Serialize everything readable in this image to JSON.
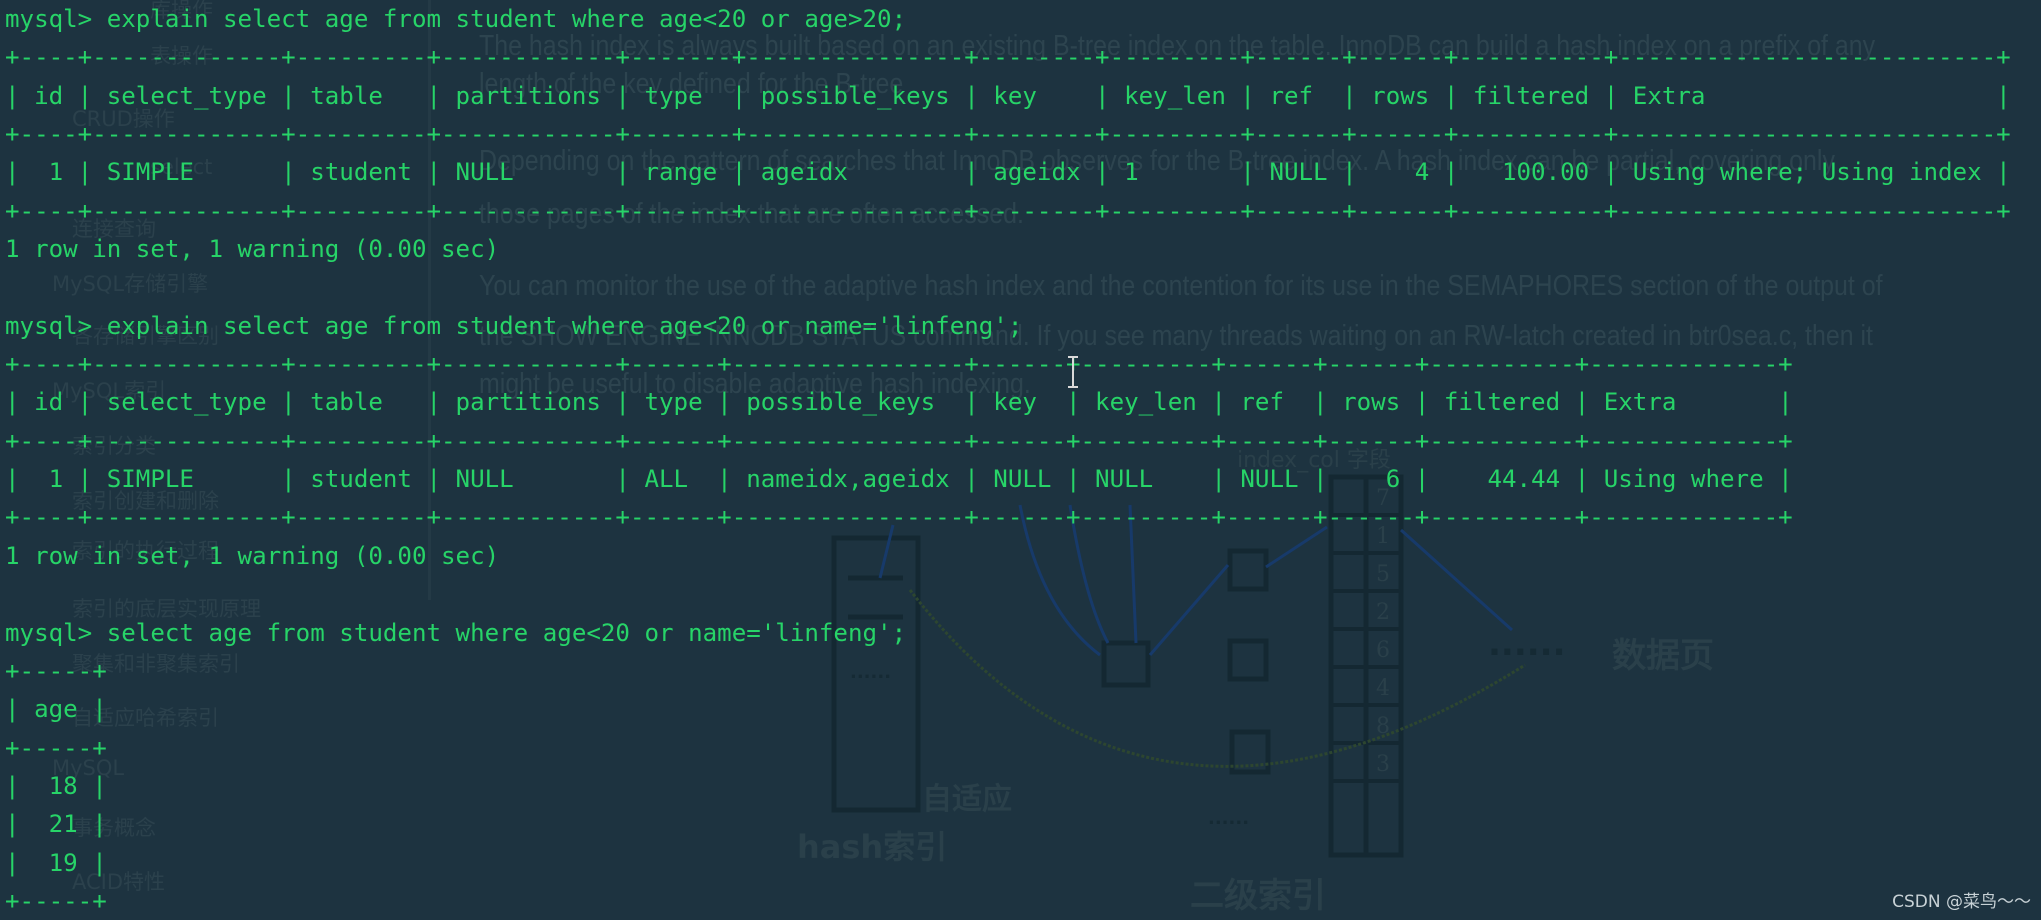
{
  "background_doc": {
    "sidebar_items": [
      "库操作",
      "表操作",
      "CRUD操作",
      "select",
      "连接查询",
      "MySQL存储引擎",
      "各存储引擎区别",
      "MySQL索引",
      "索引分类",
      "索引创建和删除",
      "索引的执行过程",
      "索引的底层实现原理",
      "聚集和非聚集索引",
      "自适应哈希索引",
      "MySQL",
      "事务概念",
      "ACID特性"
    ],
    "paragraphs": [
      "The hash index is always built based on an existing B-tree index on the table. InnoDB can build a hash index on a prefix of any",
      "length of the key defined for the B-tree",
      "Depending on the pattern of searches that InnoDB observes for the B-tree index. A hash index can be partial, covering only",
      "those pages of the index that are often accessed.",
      "You can monitor the use of the adaptive hash index and the contention for its use in the SEMAPHORES section of the output of",
      "the SHOW ENGINE INNODB STATUS command. If you see many threads waiting on an RW-latch created in btr0sea.c, then it",
      "might be useful to disable adaptive hash indexing."
    ],
    "diagram": {
      "hash_label": "hash索引",
      "adaptive_label": "自适应",
      "secondary_label": "二级索引",
      "column_label": "index_col 字段",
      "data_page_label": "数据页",
      "ellipsis": "......",
      "column_values": [
        "7",
        "1",
        "5",
        "2",
        "6",
        "4",
        "8",
        "3"
      ]
    }
  },
  "terminal": {
    "text_color": "#27d468",
    "background_color": "#1d3340",
    "lines": [
      "mysql> explain select age from student where age<20 or age>20;",
      "+----+-------------+---------+------------+-------+---------------+--------+---------+------+------+----------+--------------------------+",
      "| id | select_type | table   | partitions | type  | possible_keys | key    | key_len | ref  | rows | filtered | Extra                    |",
      "+----+-------------+---------+------------+-------+---------------+--------+---------+------+------+----------+--------------------------+",
      "|  1 | SIMPLE      | student | NULL       | range | ageidx        | ageidx | 1       | NULL |    4 |   100.00 | Using where; Using index |",
      "+----+-------------+---------+------------+-------+---------------+--------+---------+------+------+----------+--------------------------+",
      "1 row in set, 1 warning (0.00 sec)",
      "",
      "mysql> explain select age from student where age<20 or name='linfeng';",
      "+----+-------------+---------+------------+------+----------------+------+---------+------+------+----------+-------------+",
      "| id | select_type | table   | partitions | type | possible_keys  | key  | key_len | ref  | rows | filtered | Extra       |",
      "+----+-------------+---------+------------+------+----------------+------+---------+------+------+----------+-------------+",
      "|  1 | SIMPLE      | student | NULL       | ALL  | nameidx,ageidx | NULL | NULL    | NULL |    6 |    44.44 | Using where |",
      "+----+-------------+---------+------------+------+----------------+------+---------+------+------+----------+-------------+",
      "1 row in set, 1 warning (0.00 sec)",
      "",
      "mysql> select age from student where age<20 or name='linfeng';",
      "+-----+",
      "| age |",
      "+-----+",
      "|  18 |",
      "|  21 |",
      "|  19 |",
      "+-----+"
    ]
  },
  "watermark": "CSDN @菜鸟～～"
}
